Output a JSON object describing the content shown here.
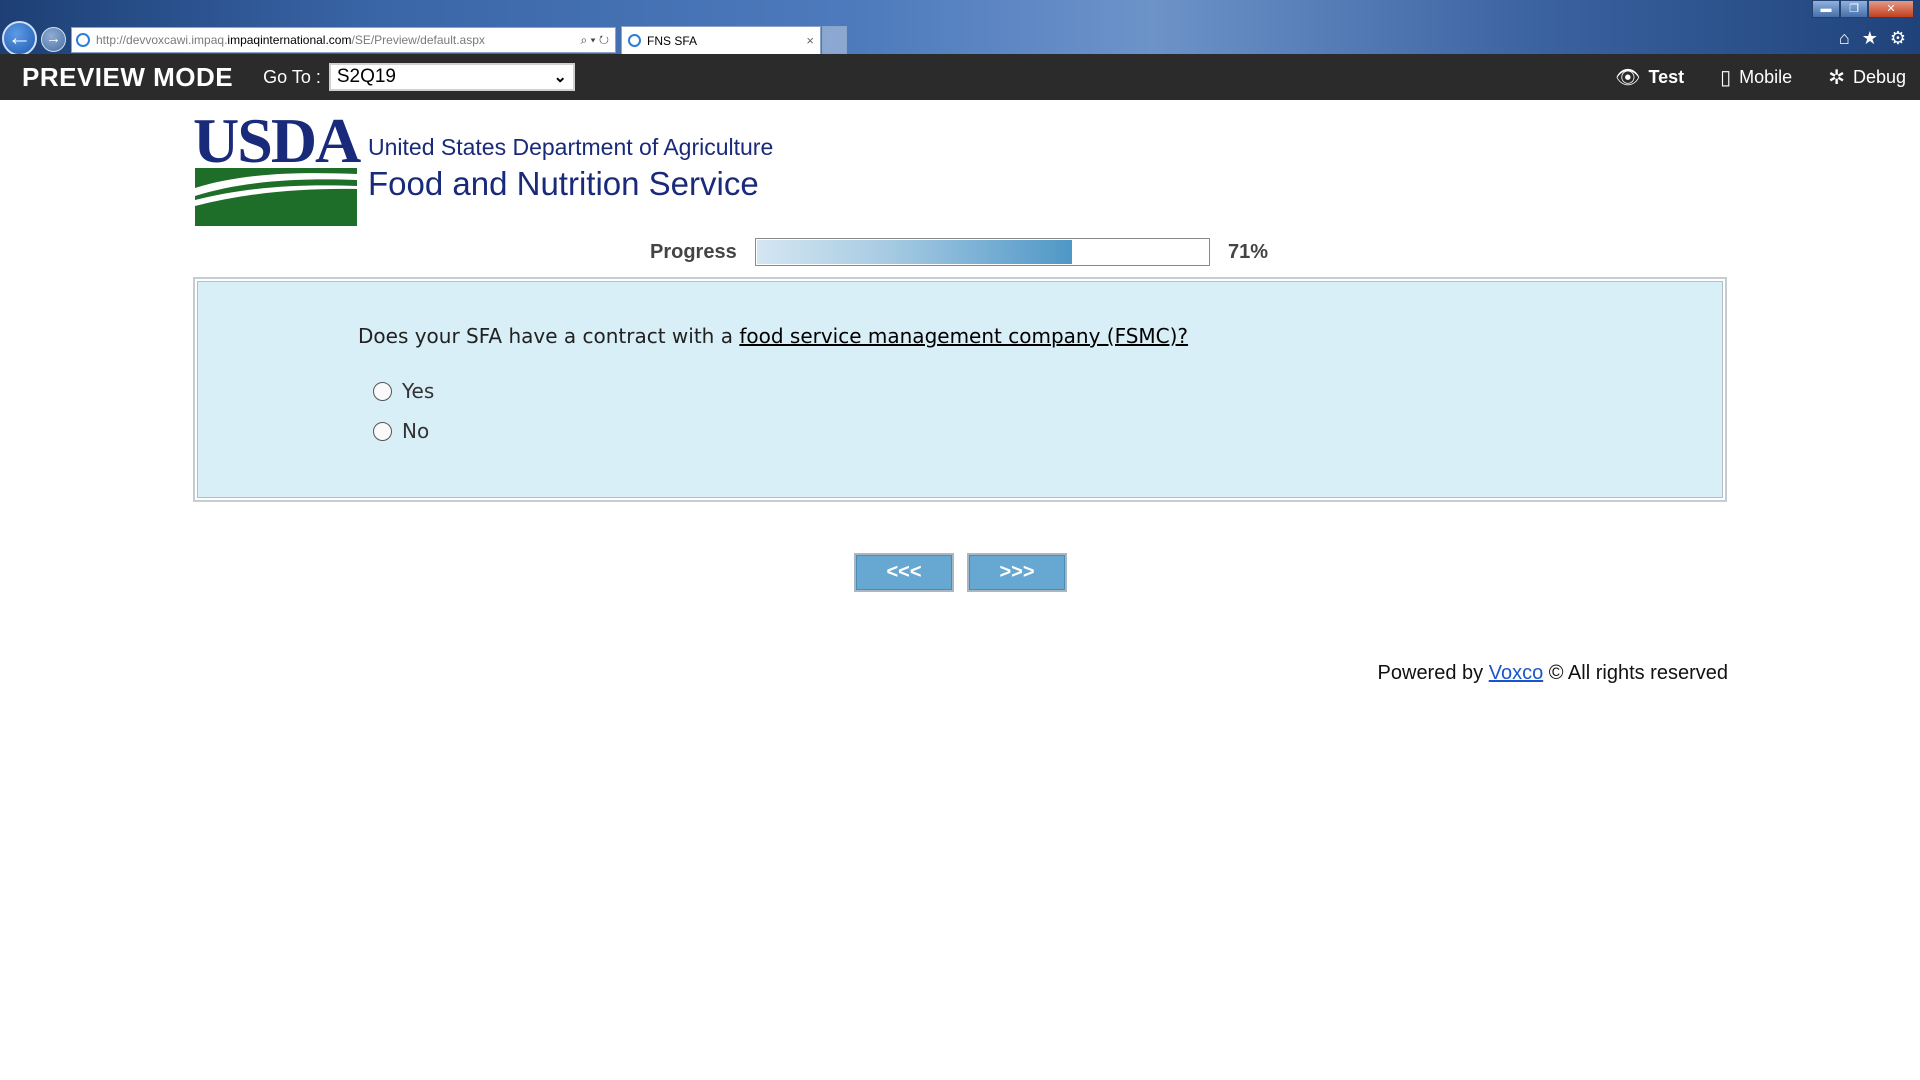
{
  "browser": {
    "url_prefix": "http://devvoxcawi.impaq.",
    "url_domain": "impaqinternational.com",
    "url_path": "/SE/Preview/default.aspx",
    "address_tools": "⌕ ▾ ↻",
    "tab_title": "FNS SFA",
    "tab_close": "×",
    "back": "←",
    "forward": "→",
    "win_min": "▬",
    "win_max": "❐",
    "win_close": "✕",
    "tools": [
      "⌂",
      "★",
      "⚙"
    ]
  },
  "preview_bar": {
    "title": "PREVIEW MODE",
    "goto_label": "Go To :",
    "goto_value": "S2Q19",
    "tools": [
      {
        "icon": "eye-icon",
        "glyph": "👁",
        "label": "Test"
      },
      {
        "icon": "mobile-icon",
        "glyph": "▯",
        "label": "Mobile"
      },
      {
        "icon": "bug-icon",
        "glyph": "✲",
        "label": "Debug"
      }
    ]
  },
  "header": {
    "logo_text": "USDA",
    "agency_line1": "United States Department of Agriculture",
    "agency_line2": "Food and Nutrition Service"
  },
  "progress": {
    "label": "Progress",
    "value": 0.71,
    "percent_text": "71%"
  },
  "question": {
    "text_before": "Does your SFA have a contract with a ",
    "link_text": "food service management company (FSMC)?",
    "options": [
      {
        "label": "Yes",
        "selected": false
      },
      {
        "label": "No",
        "selected": false
      }
    ]
  },
  "navigation": {
    "prev_label": "<<<",
    "next_label": ">>>"
  },
  "footer": {
    "prefix": "Powered by ",
    "link_text": "Voxco",
    "suffix": " © All rights reserved"
  },
  "colors": {
    "usda_blue": "#1a2a7a",
    "usda_green": "#1e6e2a",
    "panel_bg": "#d8eff7",
    "button_blue": "#66a8d1",
    "progress_fill": "#4f97c7"
  }
}
